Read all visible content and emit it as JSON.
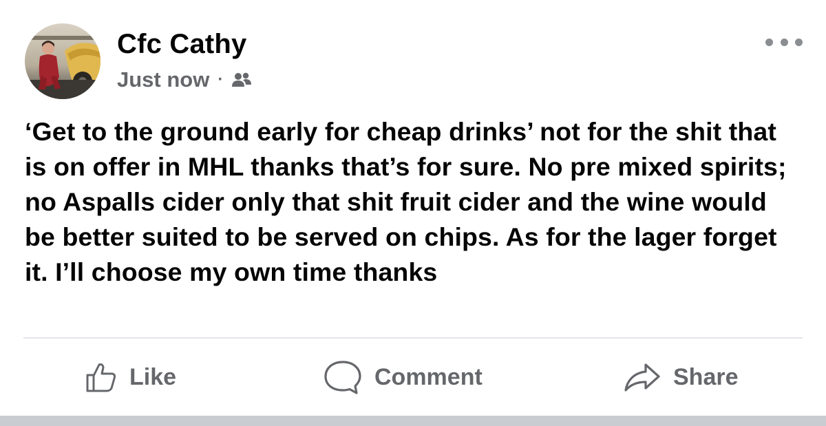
{
  "post": {
    "author": "Cfc Cathy",
    "timestamp": "Just now",
    "separator": "·",
    "audience_icon": "friends-icon",
    "more_icon": "more-options-icon",
    "text": "‘Get to the ground early for cheap drinks’ not for the shit that is on offer in MHL thanks that’s for sure. No pre mixed spirits; no Aspalls cider only that shit fruit cider and the wine would be better suited to be served on chips. As for the lager forget it. I’ll choose my own time thanks"
  },
  "actions": {
    "like_label": "Like",
    "like_icon": "thumbs-up-icon",
    "comment_label": "Comment",
    "comment_icon": "speech-bubble-icon",
    "share_label": "Share",
    "share_icon": "share-arrow-icon"
  },
  "colors": {
    "primary_text": "#050505",
    "secondary_text": "#65676b",
    "divider": "#e4e6eb",
    "footer_bar": "#c9ccd1"
  }
}
